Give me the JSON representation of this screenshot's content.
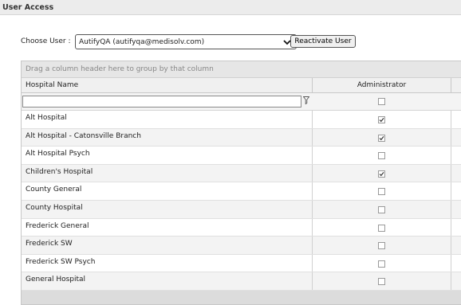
{
  "panel": {
    "title": "User Access"
  },
  "user_select": {
    "label": "Choose User :",
    "selected": "AutifyQA (autifyqa@medisolv.com)",
    "reactivate_label": "Reactivate User"
  },
  "grid": {
    "group_hint": "Drag a column header here to group by that column",
    "columns": {
      "name": "Hospital Name",
      "admin": "Administrator"
    },
    "filter": {
      "value": "",
      "admin_checked": false
    },
    "rows": [
      {
        "name": "Alt Hospital",
        "admin": true
      },
      {
        "name": "Alt Hospital - Catonsville Branch",
        "admin": true
      },
      {
        "name": "Alt Hospital Psych",
        "admin": false
      },
      {
        "name": "Children's Hospital",
        "admin": true
      },
      {
        "name": "County General",
        "admin": false
      },
      {
        "name": "County Hospital",
        "admin": false
      },
      {
        "name": "Frederick General",
        "admin": false
      },
      {
        "name": "Frederick SW",
        "admin": false
      },
      {
        "name": "Frederick SW Psych",
        "admin": false
      },
      {
        "name": "General Hospital",
        "admin": false
      }
    ]
  },
  "icons": {
    "dropdown": "chevron-down-icon",
    "filter": "filter-icon",
    "check": "checkmark-icon"
  }
}
